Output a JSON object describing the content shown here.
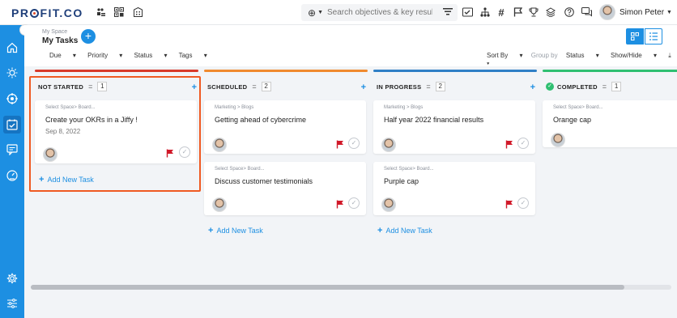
{
  "app": {
    "logo": "PR",
    "logo_rest": "FIT.CO"
  },
  "search": {
    "placeholder": "Search objectives & key results"
  },
  "user": {
    "name": "Simon Peter"
  },
  "header": {
    "breadcrumb": "My Space",
    "title": "My Tasks"
  },
  "filters": {
    "due": "Due",
    "priority": "Priority",
    "status": "Status",
    "tags": "Tags",
    "sort_by": "Sort By",
    "group_by": "Group by",
    "group_status": "Status",
    "show_hide": "Show/Hide"
  },
  "columns": [
    {
      "name": "NOT STARTED",
      "count": "1",
      "color": "#d83a2a"
    },
    {
      "name": "SCHEDULED",
      "count": "2",
      "color": "#f08a2e"
    },
    {
      "name": "IN PROGRESS",
      "count": "2",
      "color": "#2f7fc6"
    },
    {
      "name": "COMPLETED",
      "count": "1",
      "color": "#2fbf71"
    }
  ],
  "cards": {
    "ns1": {
      "meta": "Select Space> Board...",
      "title": "Create your OKRs in a Jiffy !",
      "date": "Sep 8, 2022"
    },
    "sc1": {
      "meta": "Marketing > Blogs",
      "title": "Getting ahead of cybercrime"
    },
    "sc2": {
      "meta": "Select Space> Board...",
      "title": "Discuss customer testimonials"
    },
    "ip1": {
      "meta": "Marketing > Blogs",
      "title": "Half year 2022 financial results"
    },
    "ip2": {
      "meta": "Select Space> Board...",
      "title": "Purple cap"
    },
    "cp1": {
      "meta": "Select Space> Board...",
      "title": "Orange cap"
    }
  },
  "add_task_label": "Add New Task"
}
